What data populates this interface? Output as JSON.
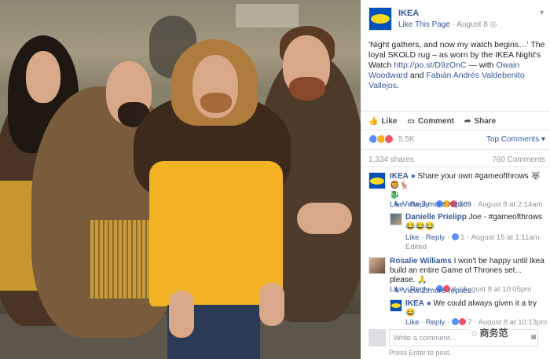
{
  "post": {
    "page_name": "IKEA",
    "like_page": "Like This Page",
    "separator": " · ",
    "date": "August 8",
    "privacy_icon": "globe-icon",
    "text_before": "'Night gathers, and now my watch begins…' The loyal SKOLD rug – as worn by the IKEA Night's Watch ",
    "link": "http://po.st/D9zOnC",
    "text_with": " — with ",
    "tag1": "Owain Woodward",
    "text_and": " and ",
    "tag2": "Fabián Andrés Valdebenito Vallejos",
    "text_end": "."
  },
  "actions": {
    "like": "Like",
    "comment": "Comment",
    "share": "Share"
  },
  "reactions": {
    "count": "5.5K",
    "top_comments": "Top Comments ▾",
    "shares": "1,334 shares",
    "comments_count": "760 Comments",
    "colors": {
      "like": "#5890ff",
      "haha": "#f7b125",
      "love": "#f25268"
    }
  },
  "comments": [
    {
      "name": "IKEA",
      "text": "Share your own #gameofthrows 🐺🦁🦌",
      "extra": "🐉",
      "like": "Like",
      "reply": "Reply",
      "count": "109",
      "date": "August 8 at 2:14am",
      "replies_link": "View 3 more replies"
    },
    {
      "name": "Danielle Prielipp",
      "text": "Joe - #gameofthrows 😂😂😂",
      "like": "Like",
      "reply": "Reply",
      "count": "1",
      "date": "August 15 at 1:11am",
      "edited": "Edited"
    },
    {
      "name": "Rosalie Williams",
      "text": "I won't be happy until Ikea build an entire Game of Thrones set... please. 🙏",
      "like": "Like",
      "reply": "Reply",
      "count": "8",
      "date": "August 8 at 10:05pm",
      "replies_link": "View 2 more replies"
    },
    {
      "name": "IKEA",
      "text": "We could always given it a try 😂",
      "like": "Like",
      "reply": "Reply",
      "count": "7",
      "date": "August 8 at 10:13pm"
    }
  ],
  "composer": {
    "placeholder": "Write a comment...",
    "hint": "Press Enter to post."
  },
  "watermark": "商务范"
}
